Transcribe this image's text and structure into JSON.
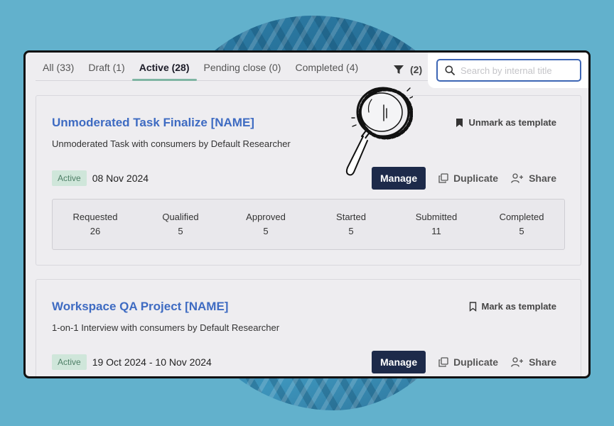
{
  "tabs": [
    {
      "label": "All (33)",
      "active": false
    },
    {
      "label": "Draft (1)",
      "active": false
    },
    {
      "label": "Active (28)",
      "active": true
    },
    {
      "label": "Pending close (0)",
      "active": false
    },
    {
      "label": "Completed (4)",
      "active": false
    }
  ],
  "filter": {
    "count_label": "(2)",
    "icon": "filter-icon"
  },
  "search": {
    "placeholder": "Search by internal title",
    "value": ""
  },
  "actions": {
    "manage": "Manage",
    "duplicate": "Duplicate",
    "share": "Share"
  },
  "colors": {
    "accent": "#3e6bc2",
    "primary_button": "#1d2a4a",
    "active_badge_bg": "#cfe6da",
    "active_tab_underline": "#7fb5a3"
  },
  "projects": [
    {
      "title": "Unmoderated Task Finalize [NAME]",
      "subtitle": "Unmoderated Task with consumers by Default Researcher",
      "template_label": "Unmark as template",
      "status": "Active",
      "date": "08 Nov 2024",
      "stats": [
        {
          "label": "Requested",
          "value": "26"
        },
        {
          "label": "Qualified",
          "value": "5"
        },
        {
          "label": "Approved",
          "value": "5"
        },
        {
          "label": "Started",
          "value": "5"
        },
        {
          "label": "Submitted",
          "value": "11"
        },
        {
          "label": "Completed",
          "value": "5"
        }
      ]
    },
    {
      "title": "Workspace QA Project [NAME]",
      "subtitle": "1-on-1 Interview with consumers by Default Researcher",
      "template_label": "Mark as template",
      "status": "Active",
      "date": "19 Oct 2024 - 10 Nov 2024"
    }
  ]
}
